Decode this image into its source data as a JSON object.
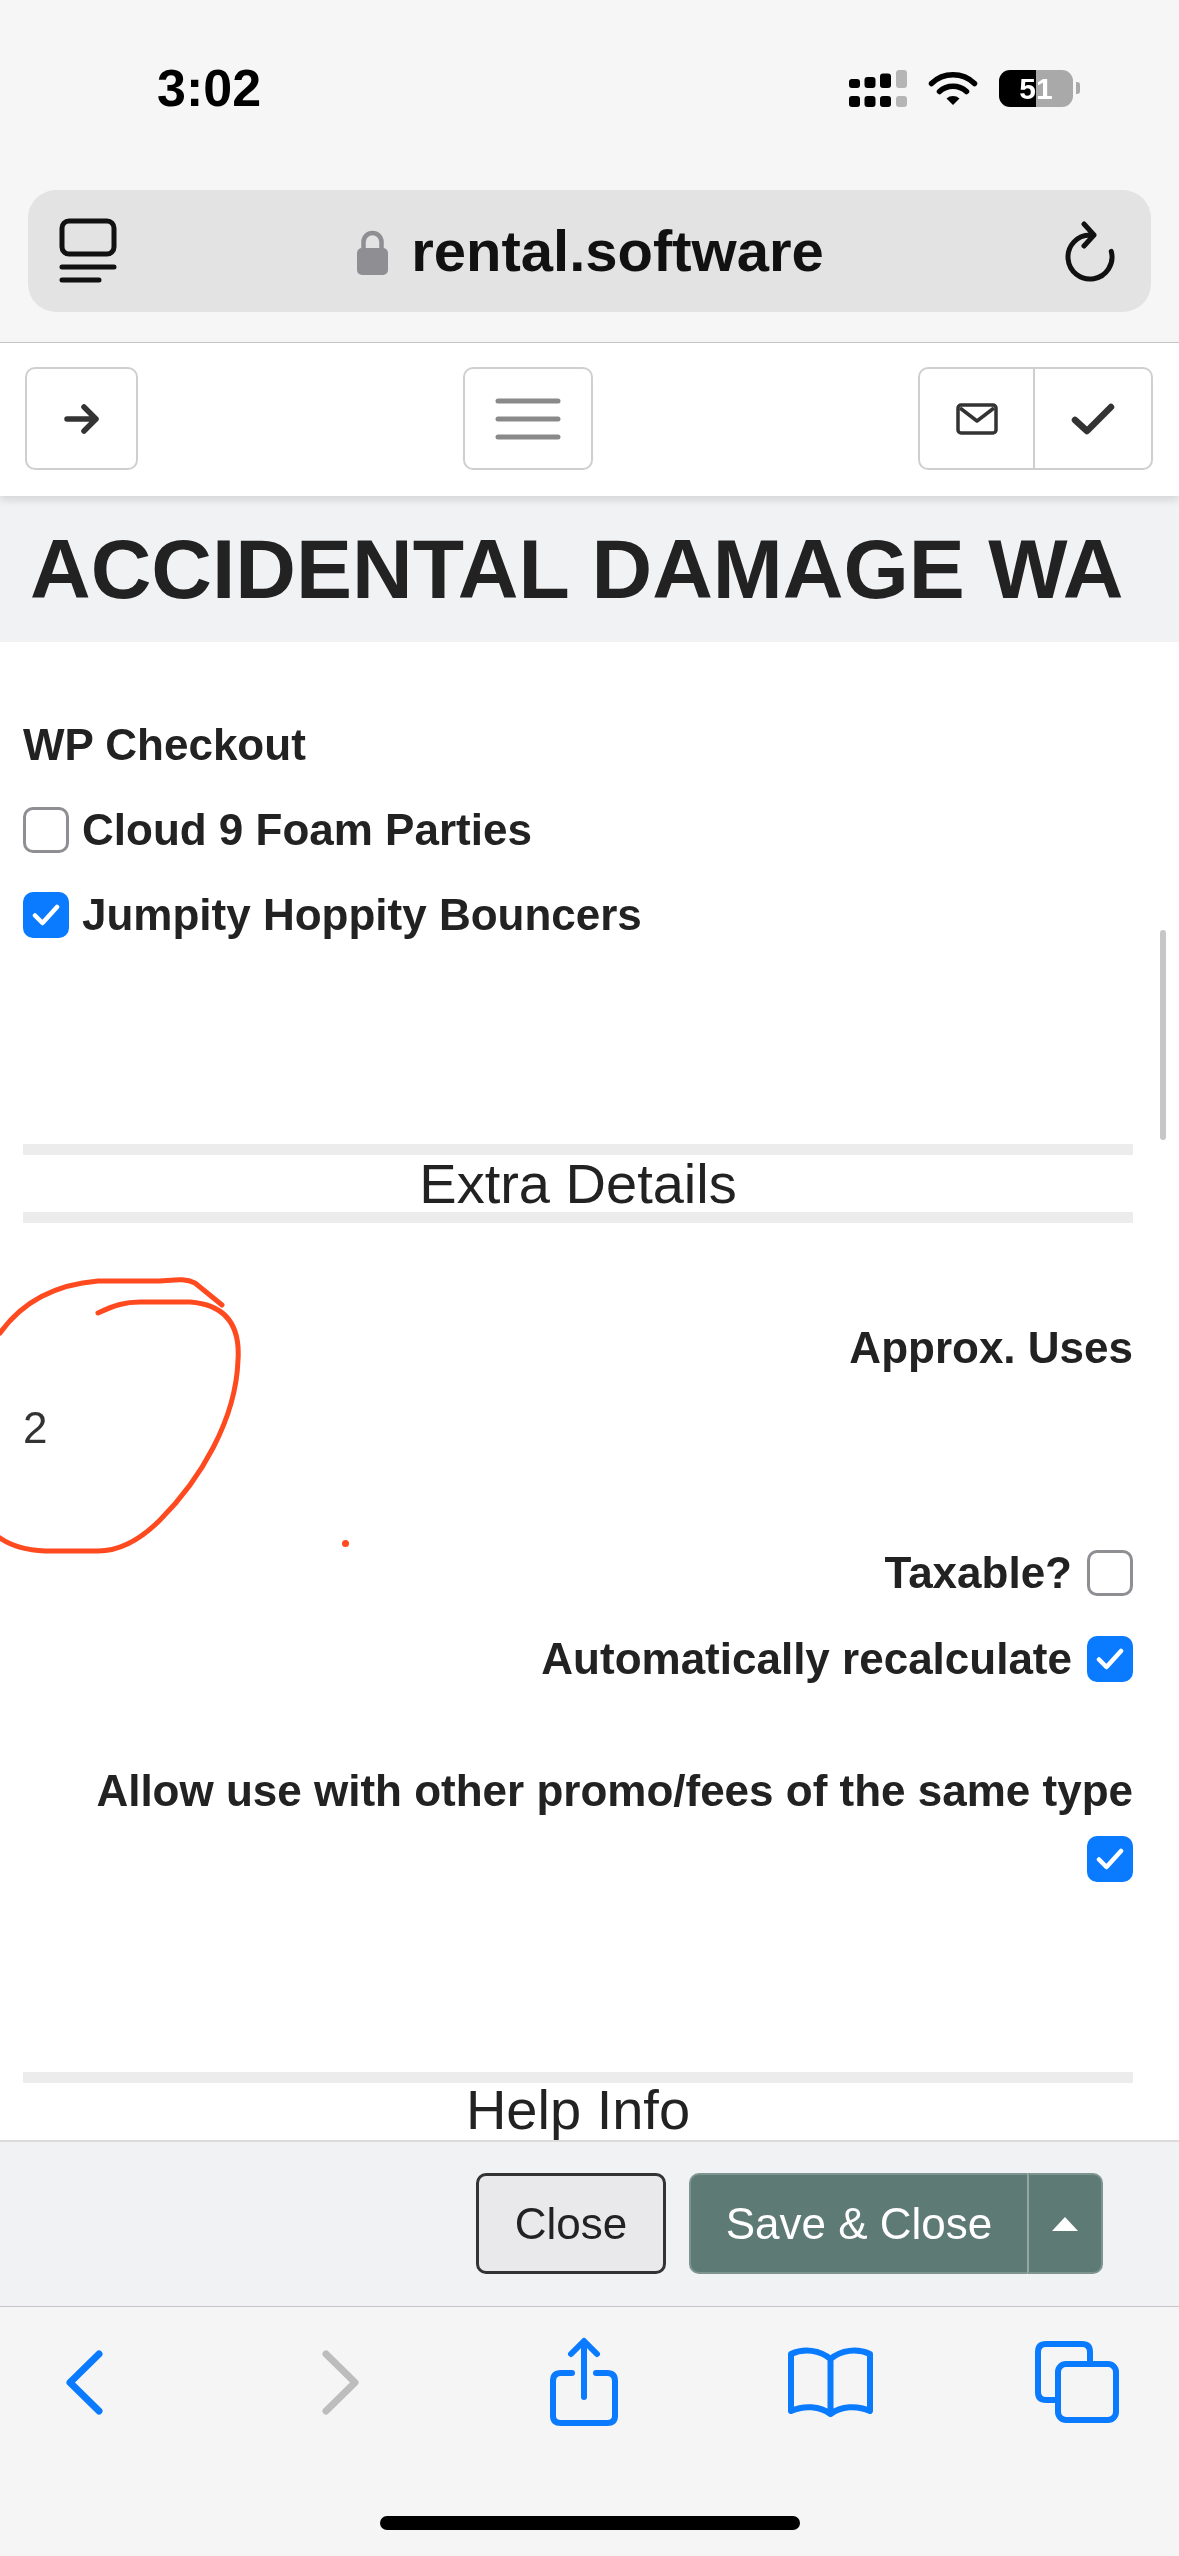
{
  "status_bar": {
    "time": "3:02",
    "battery": "51"
  },
  "address_bar": {
    "url": "rental.software"
  },
  "page_title": "ACCIDENTAL DAMAGE WA",
  "wp_checkout": {
    "label": "WP Checkout",
    "options": [
      {
        "label": "Cloud 9 Foam Parties",
        "checked": false
      },
      {
        "label": "Jumpity Hoppity Bouncers",
        "checked": true
      }
    ]
  },
  "extra_details": {
    "title": "Extra Details",
    "approx_uses": {
      "label": "Approx. Uses",
      "value": "2"
    },
    "settings": [
      {
        "kind": "inline",
        "label": "Taxable?",
        "checked": false
      },
      {
        "kind": "inline",
        "label": "Automatically recalculate",
        "checked": true
      },
      {
        "kind": "stacked",
        "label": "Allow use with other promo/fees of the same type",
        "checked": true
      }
    ]
  },
  "help_info": {
    "title": "Help Info"
  },
  "action_bar": {
    "buttons": [
      {
        "kind": "secondary",
        "label": "Close"
      },
      {
        "kind": "primary",
        "label": "Save & Close"
      }
    ]
  },
  "browser_toolbar": {
    "back": {
      "disabled": false
    },
    "forward": {
      "disabled": true
    }
  }
}
